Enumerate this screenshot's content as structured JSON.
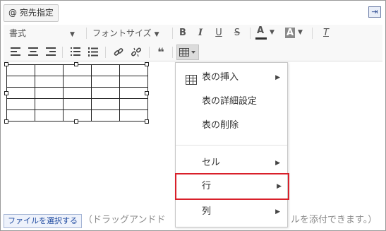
{
  "header": {
    "mention_label": "@ 宛先指定",
    "collapse_glyph": "⇥"
  },
  "toolbar": {
    "format_label": "書式",
    "font_size_label": "フォントサイズ",
    "caret": "▼",
    "bold": "B",
    "italic": "I",
    "underline": "U",
    "strike": "S",
    "font_color_letter": "A",
    "bg_color_letter": "A",
    "font_color_bar": "#2f2f2f",
    "bg_color_bar": "#8a8a8a",
    "clear_format": "T",
    "quote": "❝",
    "icons": [
      "align-left-icon",
      "align-center-icon",
      "align-right-icon",
      "bullet-list-icon",
      "numbered-list-icon",
      "link-icon",
      "unlink-icon",
      "quote-icon",
      "table-icon"
    ]
  },
  "menu": {
    "items": [
      {
        "label": "表の挿入",
        "has_submenu": true,
        "icon": "table-icon"
      },
      {
        "label": "表の詳細設定",
        "has_submenu": false
      },
      {
        "label": "表の削除",
        "has_submenu": false
      },
      {
        "label": "セル",
        "has_submenu": true
      },
      {
        "label": "行",
        "has_submenu": true,
        "highlighted": true
      },
      {
        "label": "列",
        "has_submenu": true
      }
    ],
    "arrow": "▶",
    "highlight_color": "#d9202a"
  },
  "footer": {
    "select_file_label": "ファイルを選択する",
    "hint_left": "（ドラッグアンドド",
    "hint_right": "ルを添付できます。）"
  }
}
